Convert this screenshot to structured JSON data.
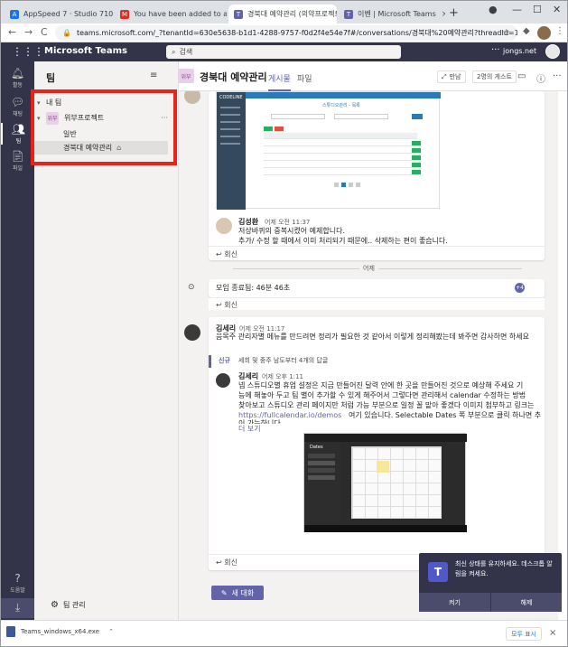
{
  "browser": {
    "tabs": [
      {
        "label": "AppSpeed 7 · Studio 710",
        "icon": "appspeed-icon",
        "color": "#1a73e8"
      },
      {
        "label": "You have been added to a te",
        "icon": "gmail-icon",
        "color": "#d93025"
      },
      {
        "label": "경북대 예약관리 (의약프로젝트",
        "icon": "teams-icon",
        "color": "#6264a7"
      },
      {
        "label": "이벤 | Microsoft Teams",
        "icon": "teams-icon",
        "color": "#6264a7"
      }
    ],
    "new_tab": "+",
    "url": "teams.microsoft.com/_?tenantId=630e5638-b1d1-4288-9757-f0d2f4e54e7f#/conversations/경북대%20예약관리?threadId=19:8831430a349e44fa8...",
    "back": "←",
    "forward": "→",
    "reload": "C"
  },
  "teams": {
    "app_name": "Microsoft Teams",
    "search_placeholder": "검색",
    "user_name": "jongs.net",
    "rail": [
      {
        "label": "활동",
        "icon": "bell-icon"
      },
      {
        "label": "채팅",
        "icon": "chat-icon"
      },
      {
        "label": "팀",
        "icon": "teams-people-icon"
      },
      {
        "label": "파일",
        "icon": "file-icon"
      }
    ],
    "help_label": "도움말",
    "download_label": ""
  },
  "pane": {
    "title": "팀",
    "tree": [
      {
        "label": "내 팀",
        "type": "section"
      },
      {
        "label": "위부프로젝트",
        "type": "team",
        "icon_text": "위부"
      },
      {
        "label": "일반",
        "type": "channel"
      },
      {
        "label": "경북대 예약관리",
        "type": "channel",
        "selected": true
      }
    ],
    "manage": "팀 관리"
  },
  "channel": {
    "team_icon_text": "위부",
    "name": "경북대 예약관리",
    "tabs": [
      "게시물",
      "파일"
    ],
    "active_tab": 0,
    "meet_label": "만남",
    "guest_label": "2명의 게스트"
  },
  "feed": {
    "shot1": {
      "app_title": "CODELINE",
      "page_title": "스튜디오관리 - 목록"
    },
    "msg1": {
      "author": "김성환",
      "time": "어제 오전 11:37",
      "lines": [
        "저상바퀴의 중복시켰어 예제합니다.",
        "추가/ 수정 할 때에서 이미 처리되기 때문에.. 삭제하는 편이 좋습니다."
      ],
      "reply": "회신"
    },
    "separator": "어제",
    "meeting": {
      "text": "모임 종료됨: 46분 46초",
      "reply": "회신",
      "badge": "+4"
    },
    "msg2": {
      "author": "김세리",
      "time": "어제 오전 11:17",
      "lines": [
        "음목주 관리자별 메뉴를 만드려면 정리가 필요한 것 같아서 이렇게 정리해봤는데 봐주면 감사하면 하세요"
      ],
      "collapsed": "세희 및 중주 남도부터 4개의 답글",
      "collapsed_prefix": "신규"
    },
    "msg3": {
      "author": "김세리",
      "time": "어제 오후 1:11",
      "lines": [
        "넵 스튜디오별 휴업 설정은 지금 만들어진 달력 안에 한 곳을 만들어진 것으로 예상해 주세요 기",
        "능에 해놓아 두고 팀 별이 추가할 수 있게 해주어서 그렇다면 관리해서 calendar 수정하는 방법",
        "찾아보고 스튜디오 관리 페이지만 처럼 가능 부분으로 일정 꼴 맡아 좋겠다 이미지 첨부하고 링크는"
      ],
      "link": "https://fullcalendar.io/demos",
      "link_tail": " 여기 있습니다. Selectable Dates 쪽 부분으로 클릭 하나면 추가하려면 하",
      "last_line": "이 가능하니다.",
      "see_more": "더 보기"
    },
    "shot2": {
      "title": "Dates"
    },
    "new_conversation": "새 대화"
  },
  "notification": {
    "logo": "T",
    "text": "최신 상태를 유지하세요. 데스크톱 알림을 켜세요.",
    "primary": "켜기",
    "secondary": "해제"
  },
  "downloads": {
    "file": "Teams_windows_x64.exe",
    "show_all": "모두 표시",
    "close": "×"
  }
}
